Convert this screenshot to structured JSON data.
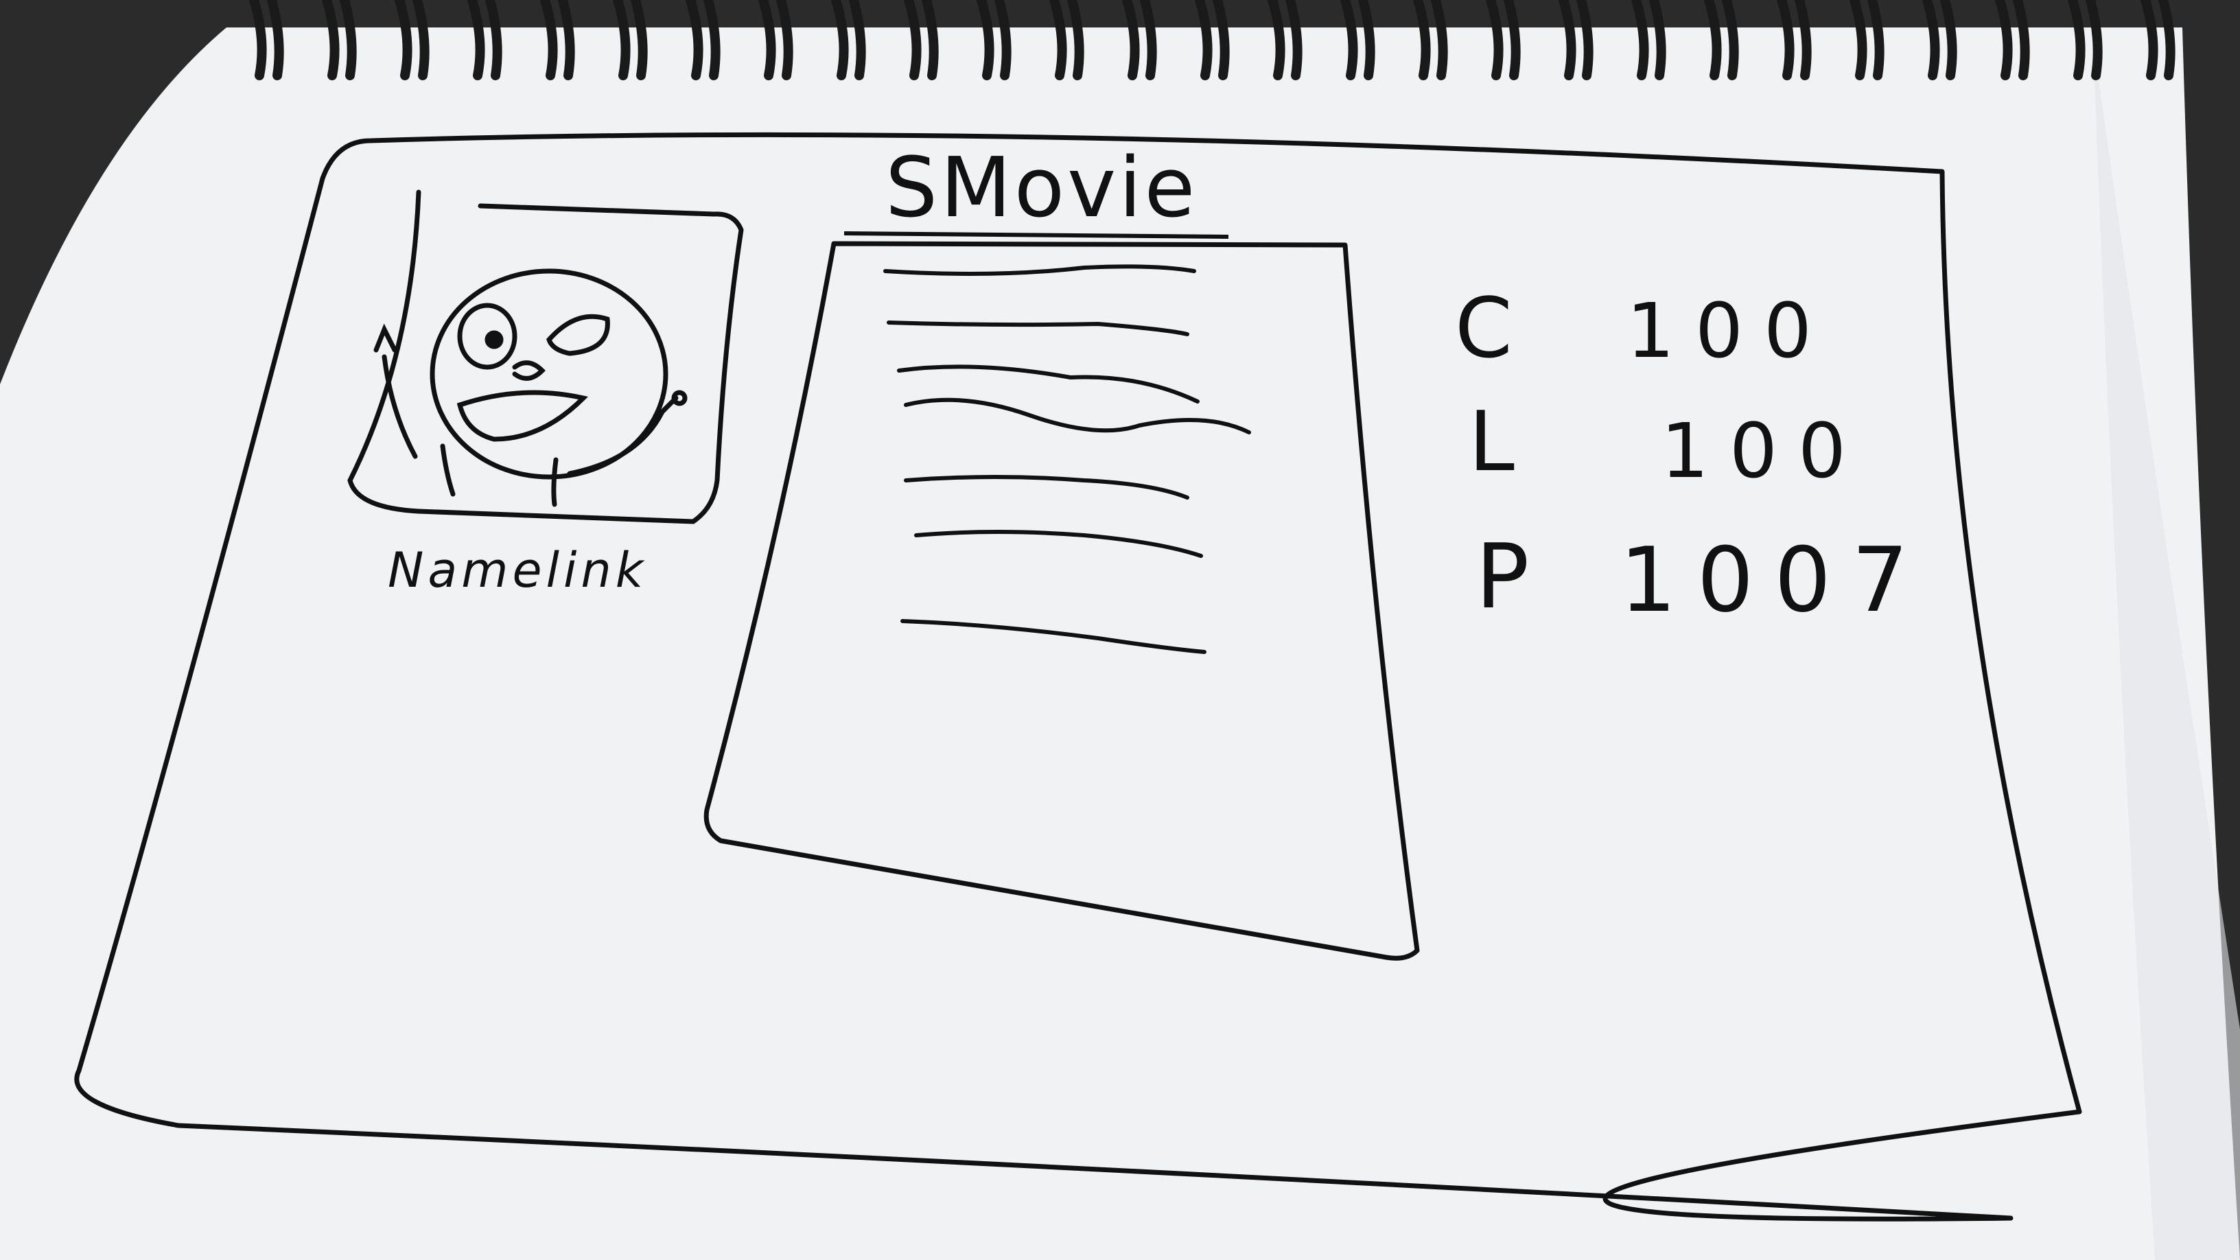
{
  "sketch": {
    "title": "SMovie",
    "profile_caption": "Namelink",
    "stats": [
      {
        "letter": "C",
        "value": "100"
      },
      {
        "letter": "L",
        "value": "100"
      },
      {
        "letter": "P",
        "value": "1007"
      }
    ],
    "text_line_count": 7
  },
  "colors": {
    "paper": "#f1f2f4",
    "ink": "#111111",
    "binding": "#1a1a1a",
    "background": "#2b2b2b"
  }
}
